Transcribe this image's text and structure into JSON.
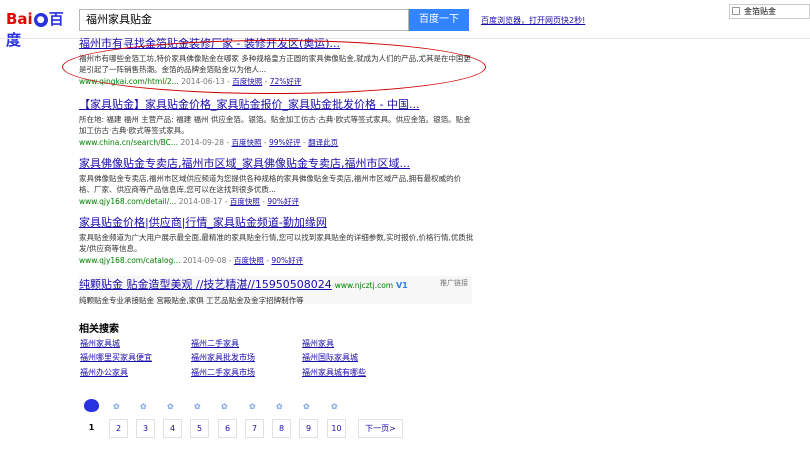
{
  "header": {
    "logo_bai": "Bai",
    "logo_paw": "du",
    "logo_baidu": "百度",
    "query": "福州家具贴金",
    "search_button": "百度一下",
    "promo_text": "百度浏览器，打开网页快2秒!",
    "right_search_value": "金箔贴金"
  },
  "results": [
    {
      "title": "福州市有寻找金箔贴金装修厂家 - 装修开发区(奥运)...",
      "desc": "福州市有哪些金箔工坊,特价家具佛像贴金在哪家 多种规格皇方正圆的家具佛像贴金,就成为人们的产品,尤其是在中国更是引起了一阵销售热潮。金箔的品牌金箔贴金以为他人...",
      "url": "www.qingkai.com/html/2...",
      "date": "2014-06-13",
      "cache": "百度快照",
      "rating": "72%好评"
    },
    {
      "title": "【家具贴金】家具贴金价格_家具贴金报价_家具贴金批发价格 - 中国...",
      "desc": "所在地: 福建 福州 主营产品: 福建 福州 供应金箔。银箔。贴金加工仿古·古典·欧式等签式家具。供应金箔。银箔。贴金加工仿古·古典·欧式等签式家具。",
      "url": "www.china.cn/search/BC...",
      "date": "2014-09-28",
      "cache": "百度快照",
      "rating": "99%好评",
      "extra": "翻译此页"
    },
    {
      "title": "家具佛像贴金专卖店,福州市区域_家具佛像贴金专卖店,福州市区域...",
      "desc": "家具佛像贴金专卖店,福州市区域供应频道为您提供各种规格的家具佛像贴金专卖店,福州市区域产品,拥有最权威的价格、厂家、供应商等产品信息库,您可以在这找到很多优质...",
      "url": "www.qjy168.com/detail/...",
      "date": "2014-08-17",
      "cache": "百度快照",
      "rating": "90%好评"
    },
    {
      "title": "家具贴金价格|供应商|行情_家具贴金频道-勤加缘网",
      "desc": "家具贴金频道为广大用户展示最全面,最精准的家具贴金行情,您可以找到家具贴金的详细参数,实时报价,价格行情,优质批发/供应商等信息。",
      "url": "www.qjy168.com/catalog...",
      "date": "2014-09-08",
      "cache": "百度快照",
      "rating": "90%好评"
    }
  ],
  "ad": {
    "title": "纯颗贴金 贴金造型美观 //技艺精湛//15950508024",
    "site": "www.njcztj.com",
    "v_badge": "V1",
    "tag": "推广链接",
    "desc": "纯颗贴金专业承接贴金 宫殿贴金,家俱 工艺品贴金及金字招牌制作等"
  },
  "related": {
    "title": "相关搜索",
    "items": [
      "福州家具城",
      "福州二手家具",
      "福州家具",
      "福州哪里买家具便宜",
      "福州家具批发市场",
      "福州国际家具城",
      "福州办公家具",
      "福州二手家具市场",
      "福州家具城有哪些"
    ]
  },
  "pagination": {
    "current": "1",
    "pages": [
      "2",
      "3",
      "4",
      "5",
      "6",
      "7",
      "8",
      "9",
      "10"
    ],
    "next": "下一页>"
  },
  "colors": {
    "brand_blue": "#3385ff",
    "link": "#1a0dab",
    "url_green": "#008000",
    "annotation_red": "#cc0000"
  }
}
